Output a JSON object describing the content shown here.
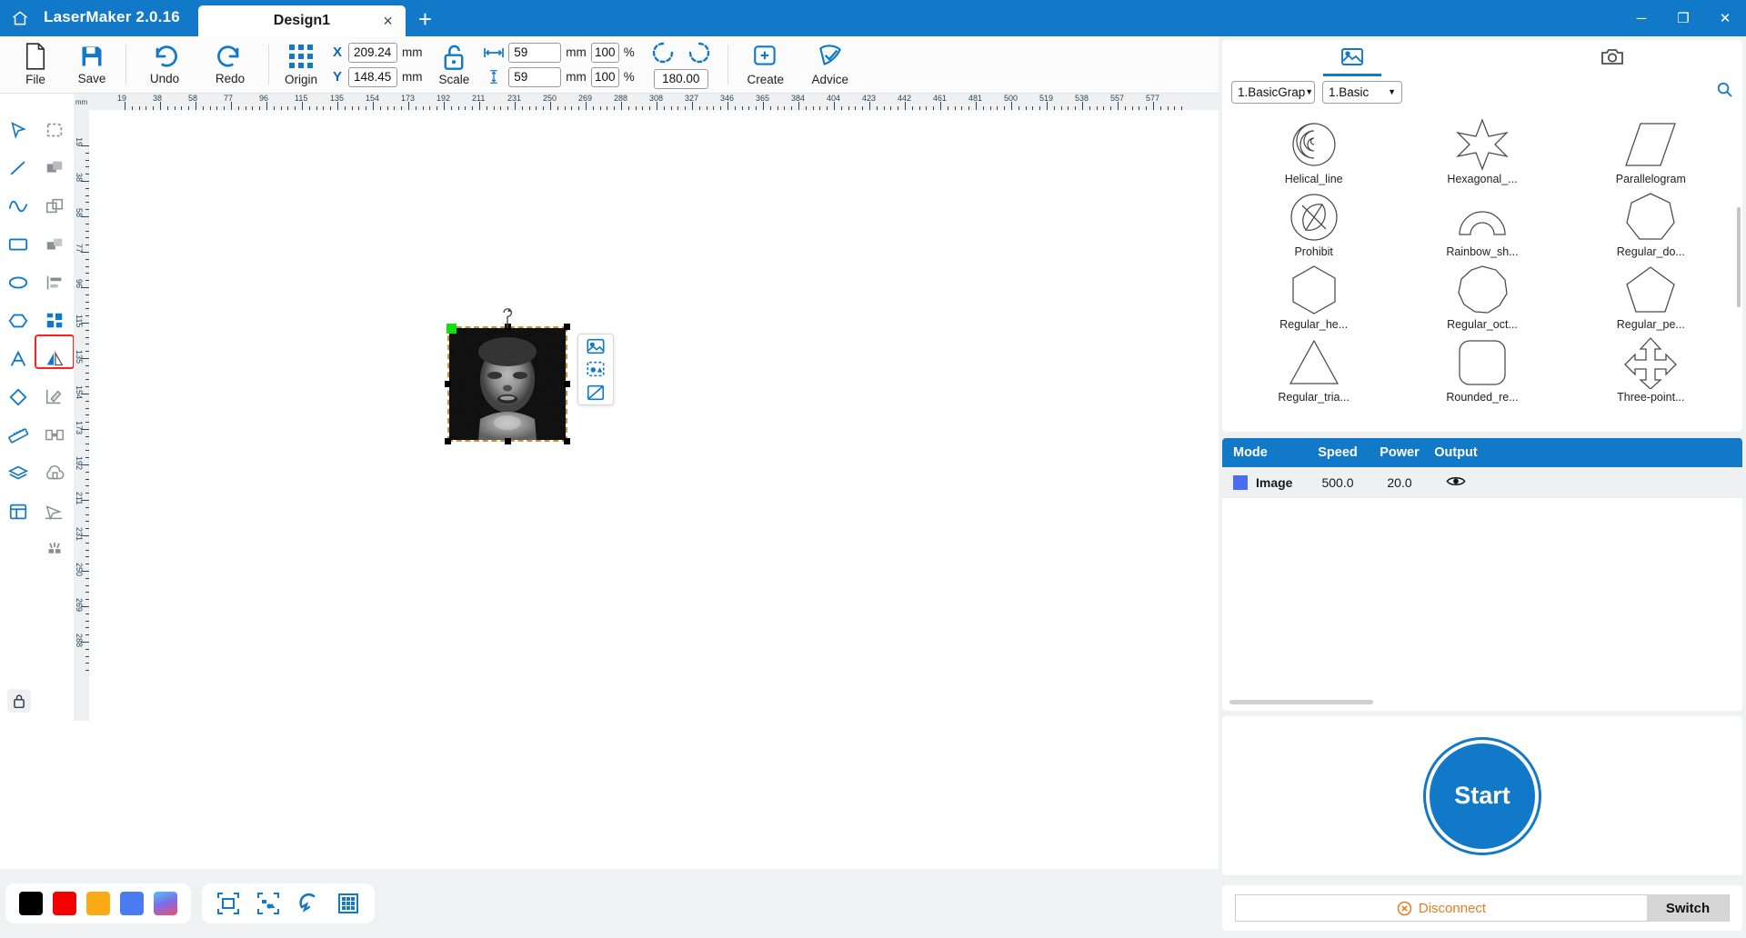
{
  "titlebar": {
    "app_name": "LaserMaker 2.0.16",
    "home_icon": "home-icon",
    "tab_label": "Design1",
    "tab_close": "×",
    "new_tab": "+",
    "minimize": "─",
    "maximize": "❐",
    "close": "✕"
  },
  "toolbar": {
    "file_label": "File",
    "save_label": "Save",
    "undo_label": "Undo",
    "redo_label": "Redo",
    "origin_label": "Origin",
    "scale_label": "Scale",
    "create_label": "Create",
    "advice_label": "Advice",
    "x_label": "X",
    "y_label": "Y",
    "x_value": "209.24",
    "y_value": "148.45",
    "x_unit": "mm",
    "y_unit": "mm",
    "width_value": "59",
    "height_value": "59",
    "width_unit": "mm",
    "height_unit": "mm",
    "width_percent": "100",
    "height_percent": "100",
    "percent_sign": "%",
    "rotation_value": "180.00"
  },
  "left_tools": {
    "col1": [
      {
        "name": "select-tool",
        "icon": "cursor-arrow-icon"
      },
      {
        "name": "line-tool",
        "icon": "line-icon"
      },
      {
        "name": "curve-tool",
        "icon": "wave-curve-icon"
      },
      {
        "name": "rectangle-tool",
        "icon": "rectangle-icon"
      },
      {
        "name": "ellipse-tool",
        "icon": "ellipse-icon"
      },
      {
        "name": "polygon-tool",
        "icon": "polygon-icon"
      },
      {
        "name": "text-tool",
        "icon": "text-a-icon"
      },
      {
        "name": "eraser-tool",
        "icon": "eraser-icon"
      },
      {
        "name": "measure-tool",
        "icon": "ruler-icon"
      },
      {
        "name": "layers-tool",
        "icon": "layers-icon"
      },
      {
        "name": "frame-tool",
        "icon": "layout-frame-icon"
      }
    ],
    "col2": [
      {
        "name": "marquee-select-tool",
        "icon": "dashed-select-icon"
      },
      {
        "name": "union-tool",
        "icon": "union-shapes-icon"
      },
      {
        "name": "duplicate-tool",
        "icon": "copy-shapes-icon"
      },
      {
        "name": "intersect-tool",
        "icon": "intersect-shapes-icon"
      },
      {
        "name": "align-tool",
        "icon": "align-left-icon"
      },
      {
        "name": "grid-arrange-tool",
        "icon": "grid-blocks-icon"
      },
      {
        "name": "mirror-flip-tool",
        "icon": "mirror-flip-icon"
      },
      {
        "name": "node-edit-tool",
        "icon": "node-pen-icon"
      },
      {
        "name": "distribute-tool",
        "icon": "distribute-icon"
      },
      {
        "name": "cloud-tool",
        "icon": "cloud-stamp-icon"
      },
      {
        "name": "path-arrow-tool",
        "icon": "path-arrow-icon"
      },
      {
        "name": "effects-tool",
        "icon": "sparkle-icon"
      }
    ],
    "lock_icon": "lock-closed-icon"
  },
  "canvas": {
    "ruler_unit": "mm",
    "h_ticks": [
      19,
      38,
      58,
      77,
      96,
      115,
      135,
      154,
      173,
      192,
      211,
      231,
      250,
      269,
      288,
      308,
      327,
      346,
      365,
      384,
      404,
      423,
      442,
      461,
      481,
      500,
      519,
      538,
      557,
      577
    ],
    "v_ticks": [
      19,
      38,
      58,
      77,
      96,
      115,
      135,
      154,
      173,
      192,
      211,
      231,
      250,
      269,
      288
    ],
    "selection": {
      "rotate_handle": "rotate-handle-icon",
      "anchor_handle": "green-anchor-handle"
    },
    "context_tools": [
      {
        "name": "edit-image-button",
        "icon": "image-edit-icon"
      },
      {
        "name": "trace-bitmap-button",
        "icon": "bitmap-trace-icon"
      },
      {
        "name": "crop-image-button",
        "icon": "crop-icon"
      }
    ]
  },
  "bottombar": {
    "swatches": [
      {
        "name": "swatch-black",
        "color": "#000000"
      },
      {
        "name": "swatch-red",
        "color": "#f50000"
      },
      {
        "name": "swatch-orange",
        "color": "#fbaa13"
      },
      {
        "name": "swatch-blue",
        "color": "#4a7bf0"
      },
      {
        "name": "swatch-gradient",
        "color": "#5ab8e8"
      }
    ],
    "tools": [
      {
        "name": "fit-frame-button",
        "icon": "frame-fit-icon"
      },
      {
        "name": "select-objects-button",
        "icon": "select-objects-icon"
      },
      {
        "name": "magnet-snap-button",
        "icon": "magnet-icon"
      },
      {
        "name": "grid-toggle-button",
        "icon": "grid-icon"
      }
    ]
  },
  "right_panel": {
    "tabs": [
      {
        "name": "tab-shape-library",
        "icon": "picture-frame-icon",
        "active": true
      },
      {
        "name": "tab-camera",
        "icon": "camera-icon",
        "active": false
      }
    ],
    "search_icon": "search-icon",
    "category_primary": "1.BasicGrap",
    "category_secondary": "1.Basic",
    "shapes": [
      {
        "label": "Helical_line",
        "icon": "spiral-icon"
      },
      {
        "label": "Hexagonal_...",
        "icon": "six-point-star-icon"
      },
      {
        "label": "Parallelogram",
        "icon": "parallelogram-icon"
      },
      {
        "label": "Prohibit",
        "icon": "prohibit-icon"
      },
      {
        "label": "Rainbow_sh...",
        "icon": "rainbow-arch-icon"
      },
      {
        "label": "Regular_do...",
        "icon": "heptagon-icon"
      },
      {
        "label": "Regular_he...",
        "icon": "hexagon-icon"
      },
      {
        "label": "Regular_oct...",
        "icon": "decagon-icon"
      },
      {
        "label": "Regular_pe...",
        "icon": "pentagon-icon"
      },
      {
        "label": "Regular_tria...",
        "icon": "triangle-icon"
      },
      {
        "label": "Rounded_re...",
        "icon": "rounded-rect-icon"
      },
      {
        "label": "Three-point...",
        "icon": "three-point-arrow-icon"
      }
    ],
    "mode_table": {
      "columns": [
        "Mode",
        "Speed",
        "Power",
        "Output"
      ],
      "rows": [
        {
          "swatch": "#4a6cf0",
          "mode": "Image",
          "speed": "500.0",
          "power": "20.0",
          "output_icon": "eye-icon"
        }
      ]
    },
    "start_label": "Start",
    "disconnect_label": "Disconnect",
    "disconnect_icon": "circle-x-icon",
    "switch_label": "Switch"
  }
}
